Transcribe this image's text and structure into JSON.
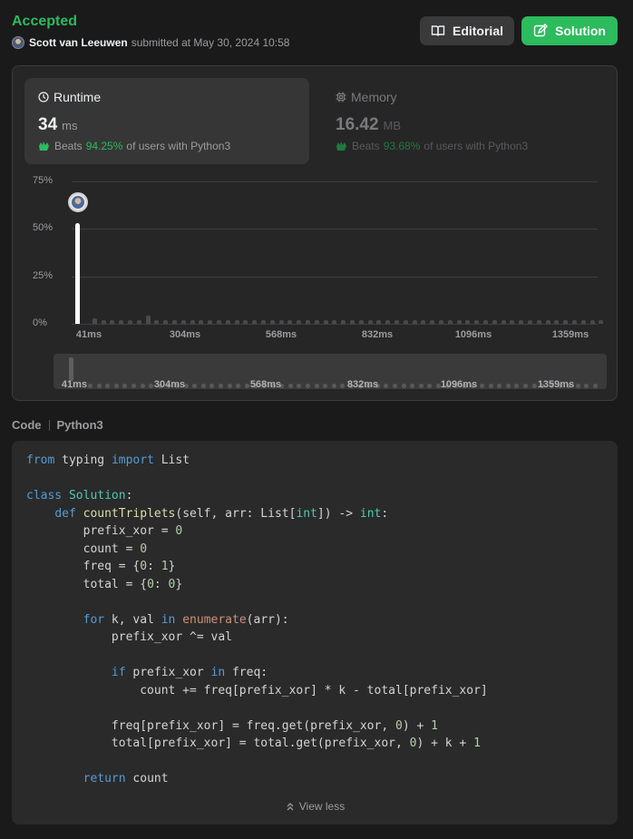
{
  "header": {
    "status": "Accepted",
    "username": "Scott van Leeuwen",
    "submitted_text": "submitted at May 30, 2024 10:58",
    "editorial_label": "Editorial",
    "solution_label": "Solution"
  },
  "runtime": {
    "title": "Runtime",
    "value": "34",
    "unit": "ms",
    "beats_prefix": "Beats",
    "beats_pct": "94.25%",
    "beats_suffix": "of users with Python3"
  },
  "memory": {
    "title": "Memory",
    "value": "16.42",
    "unit": "MB",
    "beats_prefix": "Beats",
    "beats_pct": "93.68%",
    "beats_suffix": "of users with Python3"
  },
  "chart_data": {
    "type": "bar",
    "y_ticks": [
      "75%",
      "50%",
      "25%",
      "0%"
    ],
    "ylim": [
      0,
      75
    ],
    "x_ticks": [
      "41ms",
      "304ms",
      "568ms",
      "832ms",
      "1096ms",
      "1359ms"
    ],
    "values": [
      53,
      3,
      2,
      2,
      2,
      2,
      2,
      4.5,
      2,
      2,
      2,
      2,
      2,
      2,
      2,
      2,
      2,
      2,
      2,
      2,
      2,
      2,
      2,
      2,
      2,
      2,
      2,
      2,
      2,
      2,
      2,
      2,
      2,
      2,
      2,
      2,
      2,
      2,
      2,
      2,
      2,
      2,
      2,
      2,
      2,
      2,
      2,
      2,
      2,
      2,
      2,
      2,
      2,
      2,
      2,
      2,
      2,
      2,
      2
    ],
    "highlight_index": 0,
    "colors": {
      "highlight": "#ffffff",
      "bar": "#4a4a4a",
      "accent": "#2cbb5d"
    }
  },
  "brush": {
    "x_ticks": [
      "41ms",
      "304ms",
      "568ms",
      "832ms",
      "1096ms",
      "1359ms"
    ]
  },
  "code_section": {
    "label": "Code",
    "language": "Python3",
    "view_less": "View less"
  }
}
